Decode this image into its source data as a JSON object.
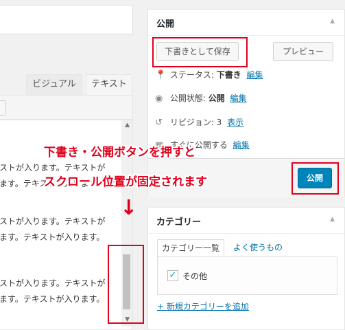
{
  "editor": {
    "tabs": {
      "visual": "ビジュアル",
      "text": "テキスト"
    },
    "paragraphs": [
      {
        "line1": "ストが入ります。テキストが",
        "line2": "ます。テキストが入ります。テキス"
      },
      {
        "line1": "ストが入ります。テキストが",
        "line2": "ます。テキストが入ります。"
      },
      {
        "line1": "ストが入ります。テキストが",
        "line2": "ます。テキストが入ります。"
      }
    ]
  },
  "publish": {
    "title": "公開",
    "save_draft": "下書きとして保存",
    "preview": "プレビュー",
    "status": {
      "label": "ステータス:",
      "value": "下書き",
      "link": "編集"
    },
    "visibility": {
      "label": "公開状態:",
      "value": "公開",
      "link": "編集"
    },
    "revisions": {
      "label": "リビジョン: 3",
      "link": "表示"
    },
    "schedule": {
      "label": "すぐに公開する",
      "link": "編集"
    },
    "publish_button": "公開"
  },
  "categories": {
    "title": "カテゴリー",
    "tab_all": "カテゴリー一覧",
    "tab_popular": "よく使うもの",
    "items": [
      {
        "label": "その他",
        "checked": true
      }
    ],
    "add_new": "+ 新規カテゴリーを追加"
  },
  "annotation": {
    "line1": "下書き・公開ボタンを押すと",
    "line2": "スクロール位置が固定されます"
  },
  "colors": {
    "annotation": "#e0001b",
    "primary_button": "#0085ba",
    "link": "#0073aa"
  }
}
